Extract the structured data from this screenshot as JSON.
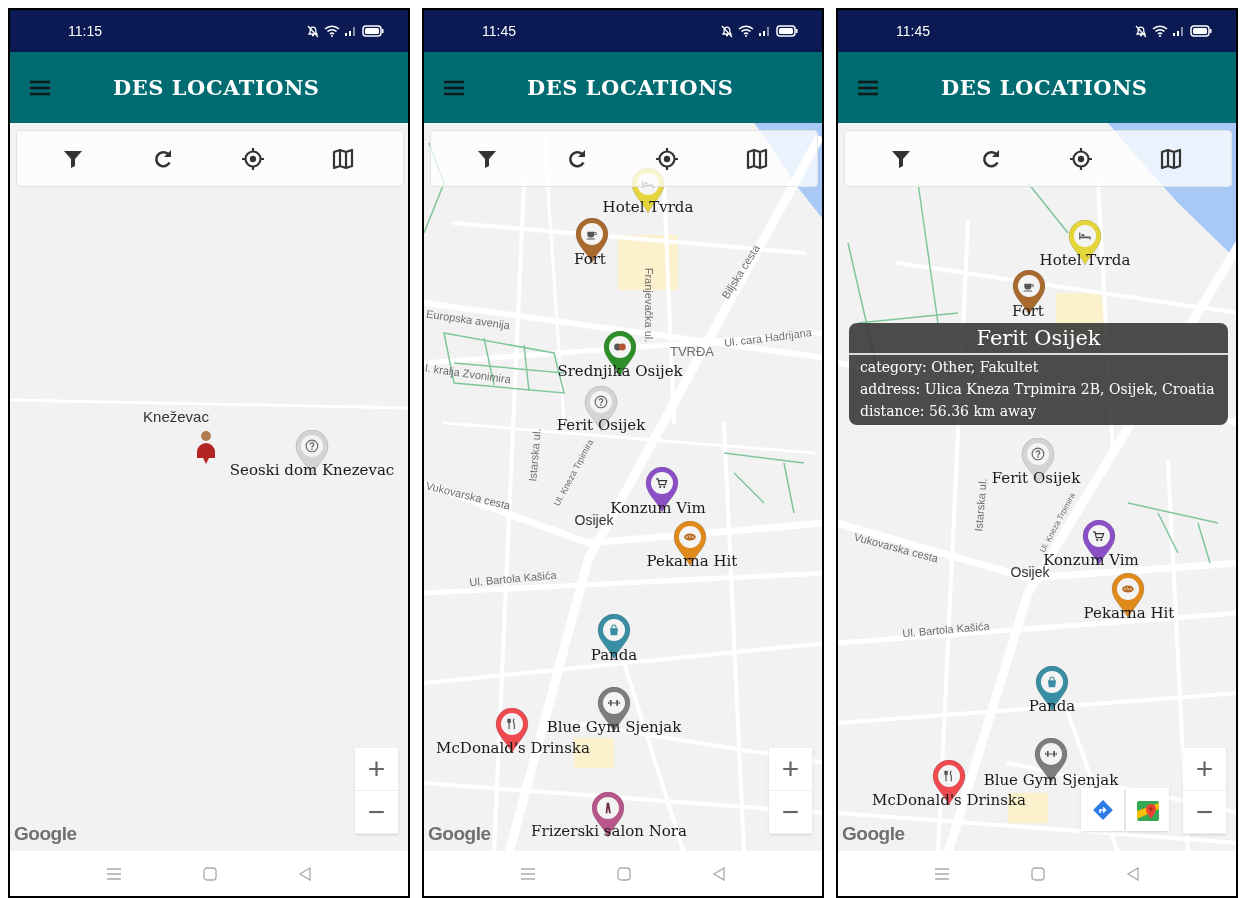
{
  "phones": [
    {
      "status_bar": {
        "time": "11:15"
      },
      "app_bar": {
        "title": "DES LOCATIONS"
      },
      "map": {
        "labels": [
          "Kneževac"
        ],
        "markers": [
          {
            "kind": "user"
          },
          {
            "label": "Seoski dom Knezevac",
            "kind": "question",
            "color": "#d4d4d4"
          }
        ],
        "zoom_controls": [
          "+",
          "−"
        ],
        "attribution": "Google"
      }
    },
    {
      "status_bar": {
        "time": "11:45"
      },
      "app_bar": {
        "title": "DES LOCATIONS"
      },
      "map": {
        "labels": [
          "Europska avenija",
          "Franjevačka ul.",
          "Biljska cesta",
          "TVRĐA",
          "Ul. cara Hadrijana",
          "l. kralja Zvonimira",
          "Istarska ul.",
          "Ul. Kneza Trpimira",
          "Vukovarska cesta",
          "Osijek",
          "Ul. Bartola Kašića"
        ],
        "markers": [
          {
            "label": "Hotel Tvrda",
            "kind": "hotel",
            "color": "#e4d63a"
          },
          {
            "label": "Fort",
            "kind": "cafe",
            "color": "#a96a2e"
          },
          {
            "label": "Srednjika Osijek",
            "kind": "school",
            "color": "#2e8f2a"
          },
          {
            "label": "Ferit Osijek",
            "kind": "question",
            "color": "#d4d4d4"
          },
          {
            "label": "Konzum Vim",
            "kind": "cart",
            "color": "#8a4fc4"
          },
          {
            "label": "Pekarna Hit",
            "kind": "bakery",
            "color": "#e0891c"
          },
          {
            "label": "Panda",
            "kind": "bag",
            "color": "#3a8ea3"
          },
          {
            "label": "Blue Gym Sjenjak",
            "kind": "gym",
            "color": "#7d7d7d"
          },
          {
            "label": "McDonald's Drinska",
            "kind": "restaurant",
            "color": "#ee4a50"
          },
          {
            "label": "Frizerski salon Nora",
            "kind": "salon",
            "color": "#b8568a"
          }
        ],
        "zoom_controls": [
          "+",
          "−"
        ],
        "attribution": "Google"
      }
    },
    {
      "status_bar": {
        "time": "11:45"
      },
      "app_bar": {
        "title": "DES LOCATIONS"
      },
      "map": {
        "labels": [
          "Istarska ul.",
          "Ul. Kneza Trpimira",
          "Vukovarska cesta",
          "Osijek",
          "Ul. Bartola Kašića"
        ],
        "markers": [
          {
            "label": "Hotel Tvrda",
            "kind": "hotel",
            "color": "#e4d63a"
          },
          {
            "label": "Fort",
            "kind": "cafe",
            "color": "#a96a2e"
          },
          {
            "label": "Ferit Osijek",
            "kind": "question",
            "color": "#d4d4d4"
          },
          {
            "label": "Konzum Vim",
            "kind": "cart",
            "color": "#8a4fc4"
          },
          {
            "label": "Pekarna Hit",
            "kind": "bakery",
            "color": "#e0891c"
          },
          {
            "label": "Panda",
            "kind": "bag",
            "color": "#3a8ea3"
          },
          {
            "label": "Blue Gym Sjenjak",
            "kind": "gym",
            "color": "#7d7d7d"
          },
          {
            "label": "McDonald's Drinska",
            "kind": "restaurant",
            "color": "#ee4a50"
          }
        ],
        "info_window": {
          "title": "Ferit Osijek",
          "lines": [
            "category: Other, Fakultet",
            "address: Ulica Kneza Trpimira 2B, Osijek, Croatia",
            "distance: 56.36 km away"
          ]
        },
        "map_buttons": [
          {
            "kind": "directions"
          },
          {
            "kind": "maps"
          }
        ],
        "zoom_controls": [
          "+",
          "−"
        ],
        "attribution": "Google"
      }
    }
  ]
}
